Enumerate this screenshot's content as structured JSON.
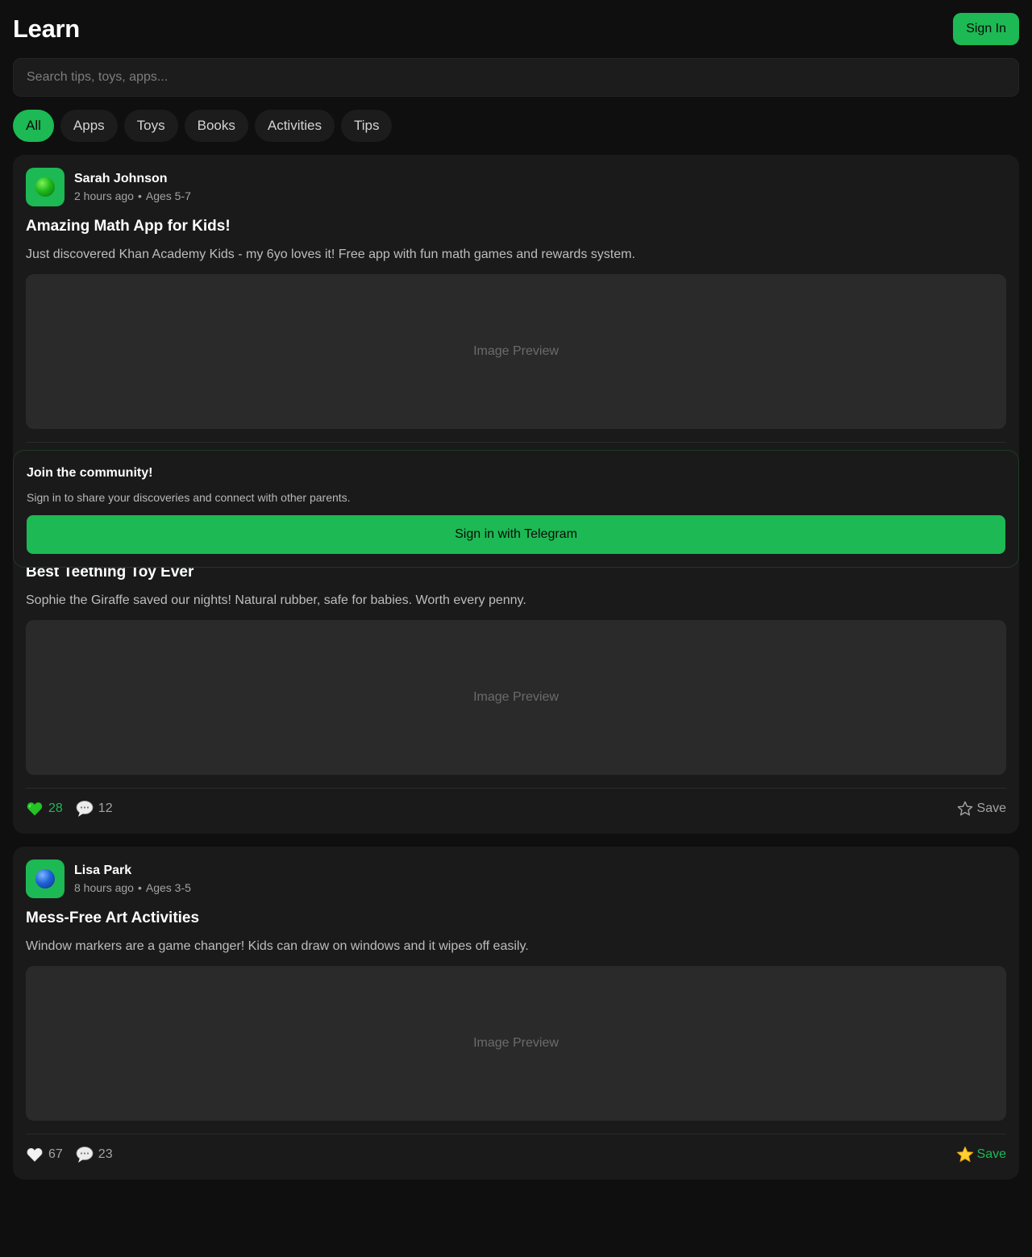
{
  "header": {
    "title": "Learn",
    "sign_in_label": "Sign In"
  },
  "search": {
    "placeholder": "Search tips, toys, apps..."
  },
  "filters": [
    {
      "label": "All",
      "active": true
    },
    {
      "label": "Apps",
      "active": false
    },
    {
      "label": "Toys",
      "active": false
    },
    {
      "label": "Books",
      "active": false
    },
    {
      "label": "Activities",
      "active": false
    },
    {
      "label": "Tips",
      "active": false
    }
  ],
  "posts": [
    {
      "author": "Sarah Johnson",
      "avatar_icon": "green-ball-icon",
      "time": "2 hours ago",
      "separator": "•",
      "ages": "Ages 5-7",
      "title": "Amazing Math App for Kids!",
      "body": "Just discovered Khan Academy Kids - my 6yo loves it! Free app with fun math games and rewards system.",
      "preview_label": "Image Preview"
    },
    {
      "title": "Best Teething Toy Ever",
      "body": "Sophie the Giraffe saved our nights! Natural rubber, safe for babies. Worth every penny.",
      "preview_label": "Image Preview",
      "likes": "28",
      "liked": true,
      "comments": "12",
      "save_label": "Save",
      "saved": false
    },
    {
      "author": "Lisa Park",
      "avatar_icon": "blue-ball-icon",
      "time": "8 hours ago",
      "separator": "•",
      "ages": "Ages 3-5",
      "title": "Mess-Free Art Activities",
      "body": "Window markers are a game changer! Kids can draw on windows and it wipes off easily.",
      "preview_label": "Image Preview",
      "likes": "67",
      "liked": false,
      "comments": "23",
      "save_label": "Save",
      "saved": true
    }
  ],
  "join": {
    "title": "Join the community!",
    "subtitle": "Sign in to share your discoveries and connect with other parents.",
    "button_label": "Sign in with Telegram"
  },
  "colors": {
    "accent": "#1db954",
    "background": "#0f0f0f",
    "card": "#1a1a1a",
    "preview": "#2a2a2a"
  }
}
